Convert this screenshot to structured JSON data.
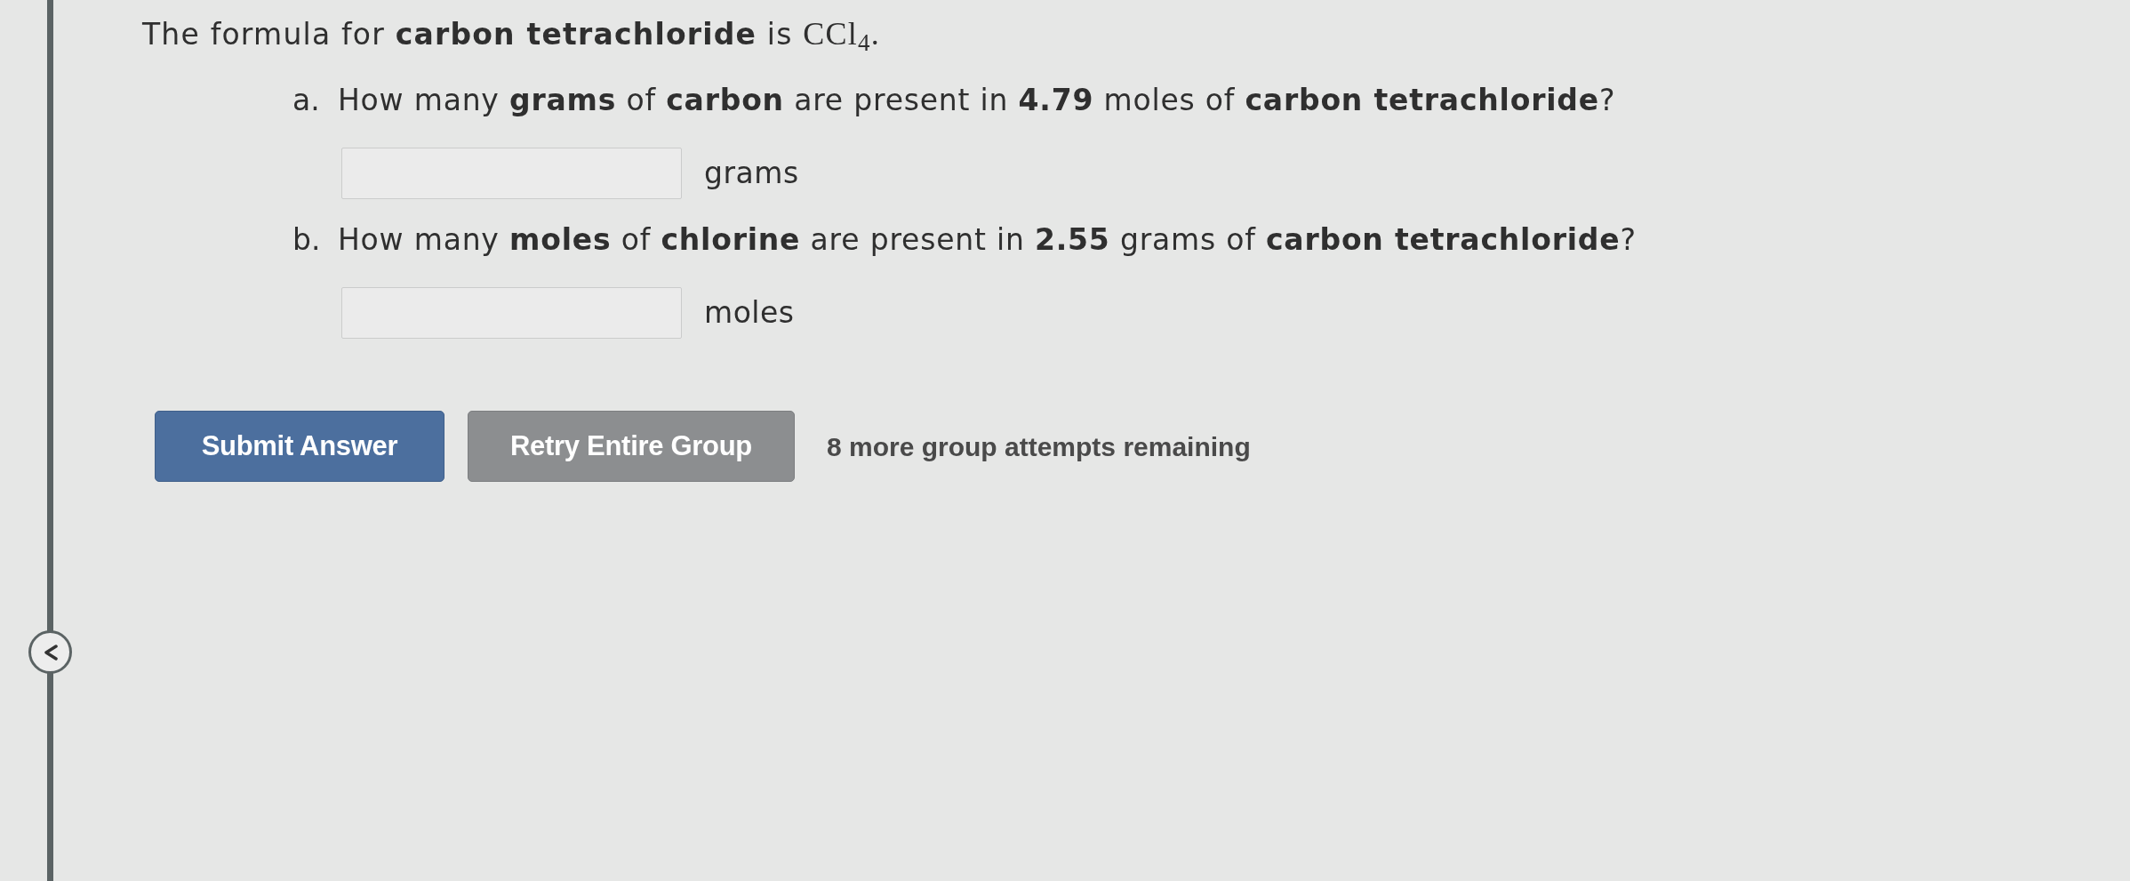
{
  "intro": {
    "text": "The formula for **carbon tetrachloride** is",
    "formula": "CCl$_{4}$."
  },
  "questions": [
    {
      "label": "a.",
      "text": "How many **grams** of **carbon** are present in **4.79** moles of **carbon tetrachloride**?",
      "unit": "grams"
    },
    {
      "label": "b.",
      "text": "How many **moles** of **chlorine** are present in **2.55** grams of **carbon tetrachloride**?",
      "unit": "moles"
    }
  ],
  "buttons": [
    {
      "label": "Submit Answer",
      "kind": "primary"
    },
    {
      "label": "Retry Entire Group",
      "kind": "secondary"
    }
  ],
  "attempts_note": "8 more group attempts remaining"
}
